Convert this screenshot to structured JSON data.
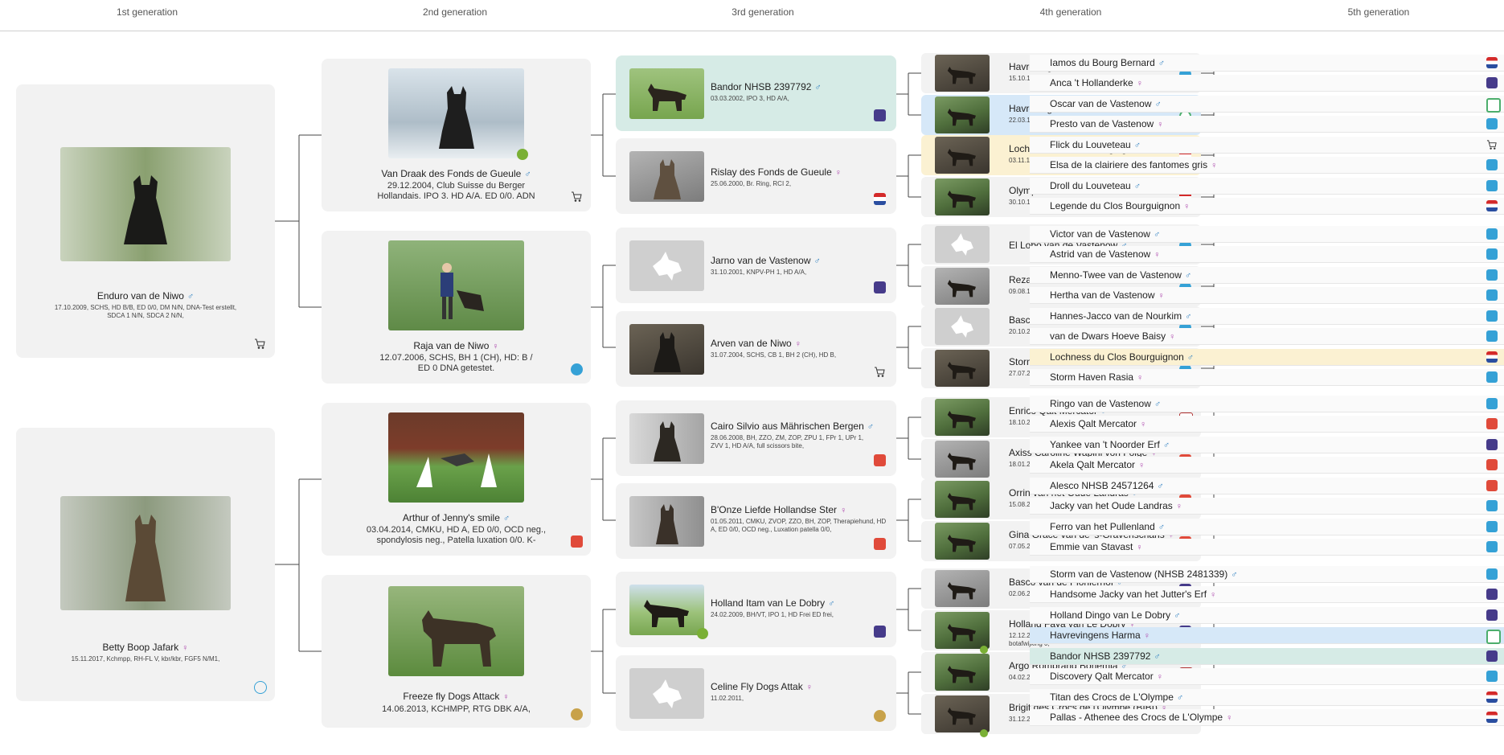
{
  "header": {
    "gen1": "1st generation",
    "gen2": "2nd generation",
    "gen3": "3rd generation",
    "gen4": "4th generation",
    "gen5": "5th generation"
  },
  "symbols": {
    "male": "♂",
    "female": "♀"
  },
  "gen1": [
    {
      "name": "Enduro van de Niwo",
      "details": "17.10.2009, SCHS, HD B/B, ED 0/0, DM N/N, DNA-Test erstellt, SDCA 1 N/N, SDCA 2 N/N,"
    },
    {
      "name": "Betty Boop Jafark",
      "details": "15.11.2017, Kchmpp, RH-FL V, kbr/kbr, FGF5 N/M1,"
    }
  ],
  "gen2": [
    {
      "name": "Van Draak des Fonds de Gueule",
      "details": "29.12.2004, Club Suisse du Berger Hollandais. IPO 3. HD A/A. ED 0/0. ADN"
    },
    {
      "name": "Raja van de Niwo",
      "details": "12.07.2006, SCHS, BH 1 (CH), HD: B / ED 0 DNA getestet."
    },
    {
      "name": "Arthur of Jenny's smile",
      "details": "03.04.2014, CMKU, HD A, ED 0/0, OCD neg., spondylosis neg., Patella luxation 0/0. K-"
    },
    {
      "name": "Freeze fly Dogs Attack",
      "details": "14.06.2013, KCHMPP, RTG DBK A/A,"
    }
  ],
  "gen3": [
    {
      "name": "Bandor NHSB 2397792",
      "details": "03.03.2002, IPO 3, HD A/A,"
    },
    {
      "name": "Rislay des Fonds de Gueule",
      "details": "25.06.2000, Br. Ring, RCI 2,"
    },
    {
      "name": "Jarno van de Vastenow",
      "details": "31.10.2001, KNPV-PH 1, HD A/A,"
    },
    {
      "name": "Arven van de Niwo",
      "details": "31.07.2004, SCHS, CB 1, BH 2 (CH), HD B,"
    },
    {
      "name": "Cairo Silvio aus Mährischen Bergen",
      "details": "28.06.2008, BH, ZZO, ZM, ZOP, ZPU 1, FPr 1, UPr 1, ZVV 1, HD A/A, full scissors bite,"
    },
    {
      "name": "B'Onze Liefde Hollandse Ster",
      "details": "01.05.2011, CMKU, ZVOP, ZZO, BH, ZOP, Therapiehund, HD A, ED 0/0, OCD neg., Luxation patella 0/0,"
    },
    {
      "name": "Holland Itam van Le Dobry",
      "details": "24.02.2009, BH/VT, IPO 1, HD Frei ED frei,"
    },
    {
      "name": "Celine Fly Dogs Attak",
      "details": "11.02.2011,"
    }
  ],
  "gen4": [
    {
      "name": "Havrevingens Furie",
      "details": "15.10.1997, IPO 3,"
    },
    {
      "name": "Havrevingens Harma",
      "details": "22.03.1999, VZH, IPO 3, A,"
    },
    {
      "name": "Lochness du Clos Bourguignon",
      "details": "03.11.1995, Ring 3, Mondio 3, HD und ED frei,"
    },
    {
      "name": "Olympe de la fureur de vivre",
      "details": "30.10.1998, Ring 1, A/A,"
    },
    {
      "name": "El Lobo van de Vastenow",
      "details": ""
    },
    {
      "name": "Reza van de Vastenow",
      "details": "09.08.1996, IPO 1,"
    },
    {
      "name": "Basco Boersma",
      "details": "20.10.2001, Zuchtzulassung mit vorzüglich, B/B,"
    },
    {
      "name": "Storm Haven Tornade",
      "details": "27.07.2002, angekört, BH 1 (CH), HD A/A ED 0/0,"
    },
    {
      "name": "Enrico Qalt Mercator",
      "details": "18.10.2001, OKV, BGH 1, HD-A,"
    },
    {
      "name": "Axiss Caroline Wapini von Folge",
      "details": "18.01.2002, ZZO, ZOP, ZPU 1, VPG A, HD 0/0,"
    },
    {
      "name": "Orrin van het Oude Landras",
      "details": "15.08.2007, Czech, BH, ZZO, ZOP, 0/0,"
    },
    {
      "name": "Gina Grace van de 's-Gravenschans",
      "details": "07.05.2006, BH, ZZO,"
    },
    {
      "name": "Basco van de Pionierhof",
      "details": "02.06.2007, BH, IPO 2, HD C,"
    },
    {
      "name": "Holland Faya van Le Dobry",
      "details": "12.12.2006, NHC, VZH, IPO 3, HD-A, norgbergwaarde 2, botafwijking 0,"
    },
    {
      "name": "Argo Rombrand Bohemia",
      "details": "04.02.2006, OEKV, BGH 1, HD A/A ED 0/0,"
    },
    {
      "name": "Brigit des Crocs de l'Olympe (BIBI)",
      "details": "31.12.2006, BH, IPO 3,"
    }
  ],
  "gen5": [
    {
      "name": "Iamos du Bourg Bernard",
      "sex": "m"
    },
    {
      "name": "Anca 't Hollanderke",
      "sex": "f"
    },
    {
      "name": "Oscar van de Vastenow",
      "sex": "m"
    },
    {
      "name": "Presto van de Vastenow",
      "sex": "f"
    },
    {
      "name": "Flick du Louveteau",
      "sex": "m"
    },
    {
      "name": "Elsa de la clairiere des fantomes gris",
      "sex": "f"
    },
    {
      "name": "Droll du Louveteau",
      "sex": "m"
    },
    {
      "name": "Legende du Clos Bourguignon",
      "sex": "f"
    },
    {
      "name": "Victor van de Vastenow",
      "sex": "m"
    },
    {
      "name": "Astrid van de Vastenow",
      "sex": "f"
    },
    {
      "name": "Menno-Twee van de Vastenow",
      "sex": "m"
    },
    {
      "name": "Hertha van de Vastenow",
      "sex": "f"
    },
    {
      "name": "Hannes-Jacco van de Nourkim",
      "sex": "m"
    },
    {
      "name": "van de Dwars Hoeve Baisy",
      "sex": "f"
    },
    {
      "name": "Lochness du Clos Bourguignon",
      "sex": "m"
    },
    {
      "name": "Storm Haven Rasia",
      "sex": "f"
    },
    {
      "name": "Ringo van de Vastenow",
      "sex": "m"
    },
    {
      "name": "Alexis Qalt Mercator",
      "sex": "f"
    },
    {
      "name": "Yankee van 't Noorder Erf",
      "sex": "m"
    },
    {
      "name": "Akela Qalt Mercator",
      "sex": "f"
    },
    {
      "name": "Alesco NHSB 24571264",
      "sex": "m"
    },
    {
      "name": "Jacky van het Oude Landras",
      "sex": "f"
    },
    {
      "name": "Ferro van het Pullenland",
      "sex": "m"
    },
    {
      "name": "Emmie van Stavast",
      "sex": "f"
    },
    {
      "name": "Storm van de Vastenow (NHSB 2481339)",
      "sex": "m"
    },
    {
      "name": "Handsome Jacky van het Jutter's Erf",
      "sex": "f"
    },
    {
      "name": "Holland Dingo van Le Dobry",
      "sex": "m"
    },
    {
      "name": "Havrevingens Harma",
      "sex": "f"
    },
    {
      "name": "Bandor NHSB 2397792",
      "sex": "m"
    },
    {
      "name": "Discovery Qalt Mercator",
      "sex": "f"
    },
    {
      "name": "Titan des Crocs de L'Olympe",
      "sex": "m"
    },
    {
      "name": "Pallas - Athenee des Crocs de L'Olympe",
      "sex": "f"
    }
  ],
  "colors": {
    "highlight_blue": "#d6e8f8",
    "highlight_yellow": "#fbf1d2",
    "highlight_teal": "#d6ebe6",
    "male": "#2d7fc0",
    "female": "#b04fb0"
  }
}
